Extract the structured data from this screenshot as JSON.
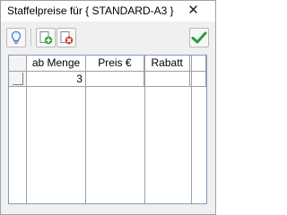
{
  "window": {
    "title": "Staffelpreise für { STANDARD-A3 }",
    "close_glyph": "✕"
  },
  "toolbar": {
    "buttons": [
      {
        "icon": "lightbulb-icon"
      },
      {
        "icon": "add-row-icon"
      },
      {
        "icon": "delete-row-icon"
      },
      {
        "icon": "checkmark-icon"
      }
    ]
  },
  "grid": {
    "columns": [
      "ab Menge",
      "Preis €",
      "Rabatt"
    ],
    "rows": [
      {
        "ab_menge": "3",
        "preis": "",
        "rabatt": ""
      }
    ]
  },
  "colors": {
    "add": "#2e9e2e",
    "delete": "#d23a2a",
    "ok": "#2f9b3a",
    "bulb": "#3a7fd0"
  }
}
